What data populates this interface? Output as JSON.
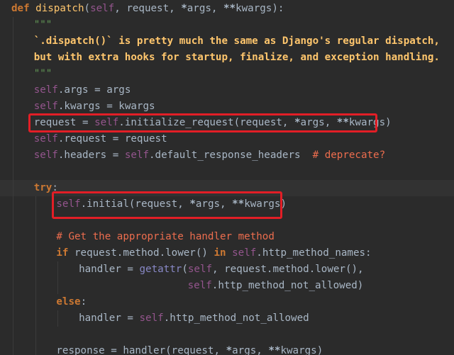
{
  "editor": {
    "lines": [
      {
        "indent": 0,
        "tokens": [
          [
            "kw",
            "def "
          ],
          [
            "fn",
            "dispatch"
          ],
          [
            "plain",
            "("
          ],
          [
            "param",
            "self"
          ],
          [
            "plain",
            ", request, "
          ],
          [
            "op",
            "*"
          ],
          [
            "plain",
            "args, "
          ],
          [
            "op",
            "**"
          ],
          [
            "plain",
            "kwargs):"
          ]
        ]
      },
      {
        "indent": 1,
        "tokens": [
          [
            "docq",
            "\"\"\""
          ]
        ]
      },
      {
        "indent": 1,
        "tokens": [
          [
            "doc",
            "`.dispatch()` is pretty much the same as Django's regular dispatch,"
          ]
        ]
      },
      {
        "indent": 1,
        "tokens": [
          [
            "doc",
            "but with extra hooks for startup, finalize, and exception handling."
          ]
        ]
      },
      {
        "indent": 1,
        "tokens": [
          [
            "docq",
            "\"\"\""
          ]
        ]
      },
      {
        "indent": 1,
        "tokens": [
          [
            "selfk",
            "self"
          ],
          [
            "plain",
            ".args = args"
          ]
        ]
      },
      {
        "indent": 1,
        "tokens": [
          [
            "selfk",
            "self"
          ],
          [
            "plain",
            ".kwargs = kwargs"
          ]
        ]
      },
      {
        "indent": 1,
        "tokens": [
          [
            "plain",
            "request = "
          ],
          [
            "selfk",
            "self"
          ],
          [
            "plain",
            ".initialize_request(request, "
          ],
          [
            "op",
            "*"
          ],
          [
            "plain",
            "args, "
          ],
          [
            "op",
            "**"
          ],
          [
            "plain",
            "kwargs)"
          ]
        ]
      },
      {
        "indent": 1,
        "tokens": [
          [
            "selfk",
            "self"
          ],
          [
            "plain",
            ".request = request"
          ]
        ]
      },
      {
        "indent": 1,
        "tokens": [
          [
            "selfk",
            "self"
          ],
          [
            "plain",
            ".headers = "
          ],
          [
            "selfk",
            "self"
          ],
          [
            "plain",
            ".default_response_headers  "
          ],
          [
            "cmt",
            "# deprecate?"
          ]
        ]
      },
      {
        "indent": 1,
        "tokens": []
      },
      {
        "indent": 1,
        "tokens": [
          [
            "kw",
            "try"
          ],
          [
            "plain",
            ":"
          ]
        ],
        "current": true
      },
      {
        "indent": 2,
        "tokens": [
          [
            "selfk",
            "self"
          ],
          [
            "plain",
            ".initial(request, "
          ],
          [
            "op",
            "*"
          ],
          [
            "plain",
            "args, "
          ],
          [
            "op",
            "**"
          ],
          [
            "plain",
            "kwargs)"
          ]
        ]
      },
      {
        "indent": 2,
        "tokens": []
      },
      {
        "indent": 2,
        "tokens": [
          [
            "cmt",
            "# Get the appropriate handler method"
          ]
        ]
      },
      {
        "indent": 2,
        "tokens": [
          [
            "kw",
            "if "
          ],
          [
            "plain",
            "request.method.lower() "
          ],
          [
            "kw",
            "in "
          ],
          [
            "selfk",
            "self"
          ],
          [
            "plain",
            ".http_method_names:"
          ]
        ]
      },
      {
        "indent": 3,
        "tokens": [
          [
            "plain",
            "handler = "
          ],
          [
            "builtin",
            "getattr"
          ],
          [
            "plain",
            "("
          ],
          [
            "selfk",
            "self"
          ],
          [
            "plain",
            ", request.method.lower(),"
          ]
        ]
      },
      {
        "indent": 3,
        "pad": 18,
        "tokens": [
          [
            "selfk",
            "self"
          ],
          [
            "plain",
            ".http_method_not_allowed)"
          ]
        ]
      },
      {
        "indent": 2,
        "tokens": [
          [
            "kw",
            "else"
          ],
          [
            "plain",
            ":"
          ]
        ]
      },
      {
        "indent": 3,
        "tokens": [
          [
            "plain",
            "handler = "
          ],
          [
            "selfk",
            "self"
          ],
          [
            "plain",
            ".http_method_not_allowed"
          ]
        ]
      },
      {
        "indent": 2,
        "tokens": []
      },
      {
        "indent": 2,
        "tokens": [
          [
            "plain",
            "response = handler(request, "
          ],
          [
            "op",
            "*"
          ],
          [
            "plain",
            "args, "
          ],
          [
            "op",
            "**"
          ],
          [
            "plain",
            "kwargs)"
          ]
        ]
      }
    ],
    "highlight_boxes": [
      {
        "name": "highlight-initialize-request"
      },
      {
        "name": "highlight-initial"
      }
    ]
  }
}
